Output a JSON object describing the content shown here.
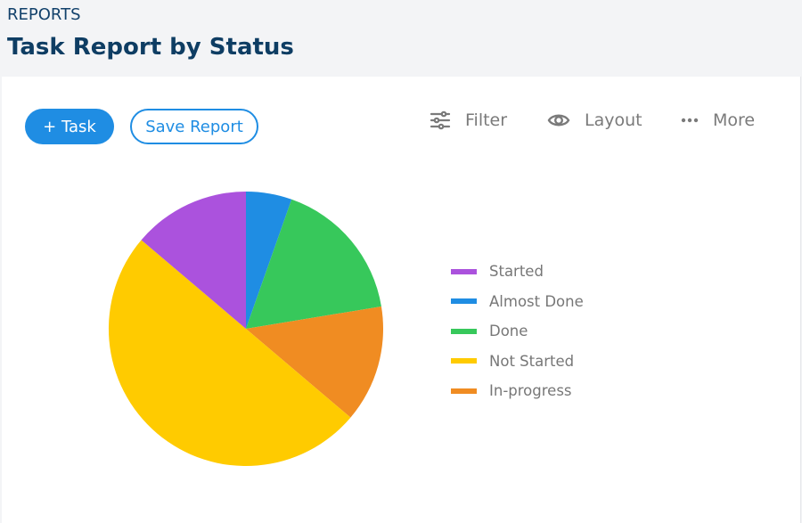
{
  "header": {
    "breadcrumb": "REPORTS",
    "title": "Task Report by Status"
  },
  "toolbar": {
    "add_task_label": "+ Task",
    "save_report_label": "Save Report",
    "filter_label": "Filter",
    "filter_icon": "sliders-icon",
    "layout_label": "Layout",
    "layout_icon": "eye-icon",
    "more_label": "More",
    "more_icon": "ellipsis-icon"
  },
  "colors": {
    "accent": "#1f8de3",
    "title": "#0e3d63",
    "toolbar_text": "#7a7a7a"
  },
  "chart_data": {
    "type": "pie",
    "title": "",
    "legend_position": "right",
    "start_angle": "top, clockwise",
    "slices": [
      {
        "label": "Almost Done",
        "value": 5.4,
        "color": "#1f8de3"
      },
      {
        "label": "Done",
        "value": 17.0,
        "color": "#37c85b"
      },
      {
        "label": "In-progress",
        "value": 13.8,
        "color": "#f08c22"
      },
      {
        "label": "Not Started",
        "value": 50.0,
        "color": "#ffcb00"
      },
      {
        "label": "Started",
        "value": 13.8,
        "color": "#ab52dd"
      }
    ],
    "legend": [
      {
        "label": "Started",
        "color": "#ab52dd"
      },
      {
        "label": "Almost Done",
        "color": "#1f8de3"
      },
      {
        "label": "Done",
        "color": "#37c85b"
      },
      {
        "label": "Not Started",
        "color": "#ffcb00"
      },
      {
        "label": "In-progress",
        "color": "#f08c22"
      }
    ]
  }
}
